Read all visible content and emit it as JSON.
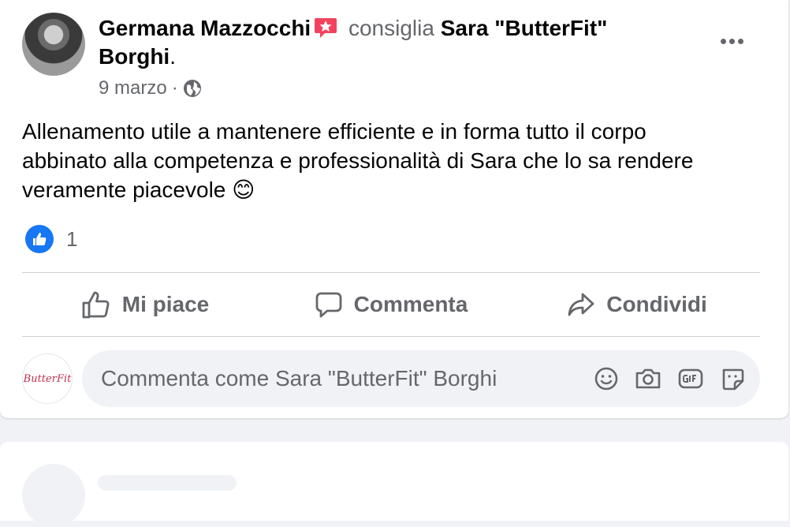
{
  "post": {
    "author": "Germana Mazzocchi",
    "verb": "consiglia",
    "page_name_line1": "Sara \"ButterFit\"",
    "page_name_line2": "Borghi",
    "period": ".",
    "date": "9 marzo",
    "separator": "·",
    "audience_icon": "globe-icon",
    "body_line1": "Allenamento utile a mantenere efficiente e in forma tutto il corpo",
    "body_line2": "abbinato alla competenza e professionalità di Sara che lo sa rendere",
    "body_line3": "veramente piacevole",
    "emoji": "😊",
    "like_count": "1",
    "accent_color": "#1877f2",
    "recommend_color": "#f3425f"
  },
  "actions": {
    "like_label": "Mi piace",
    "comment_label": "Commenta",
    "share_label": "Condividi"
  },
  "comment_box": {
    "avatar_label": "ButterFit",
    "placeholder": "Commenta come Sara \"ButterFit\" Borghi",
    "icons": [
      "emoji-icon",
      "camera-icon",
      "gif-icon",
      "sticker-icon"
    ]
  }
}
